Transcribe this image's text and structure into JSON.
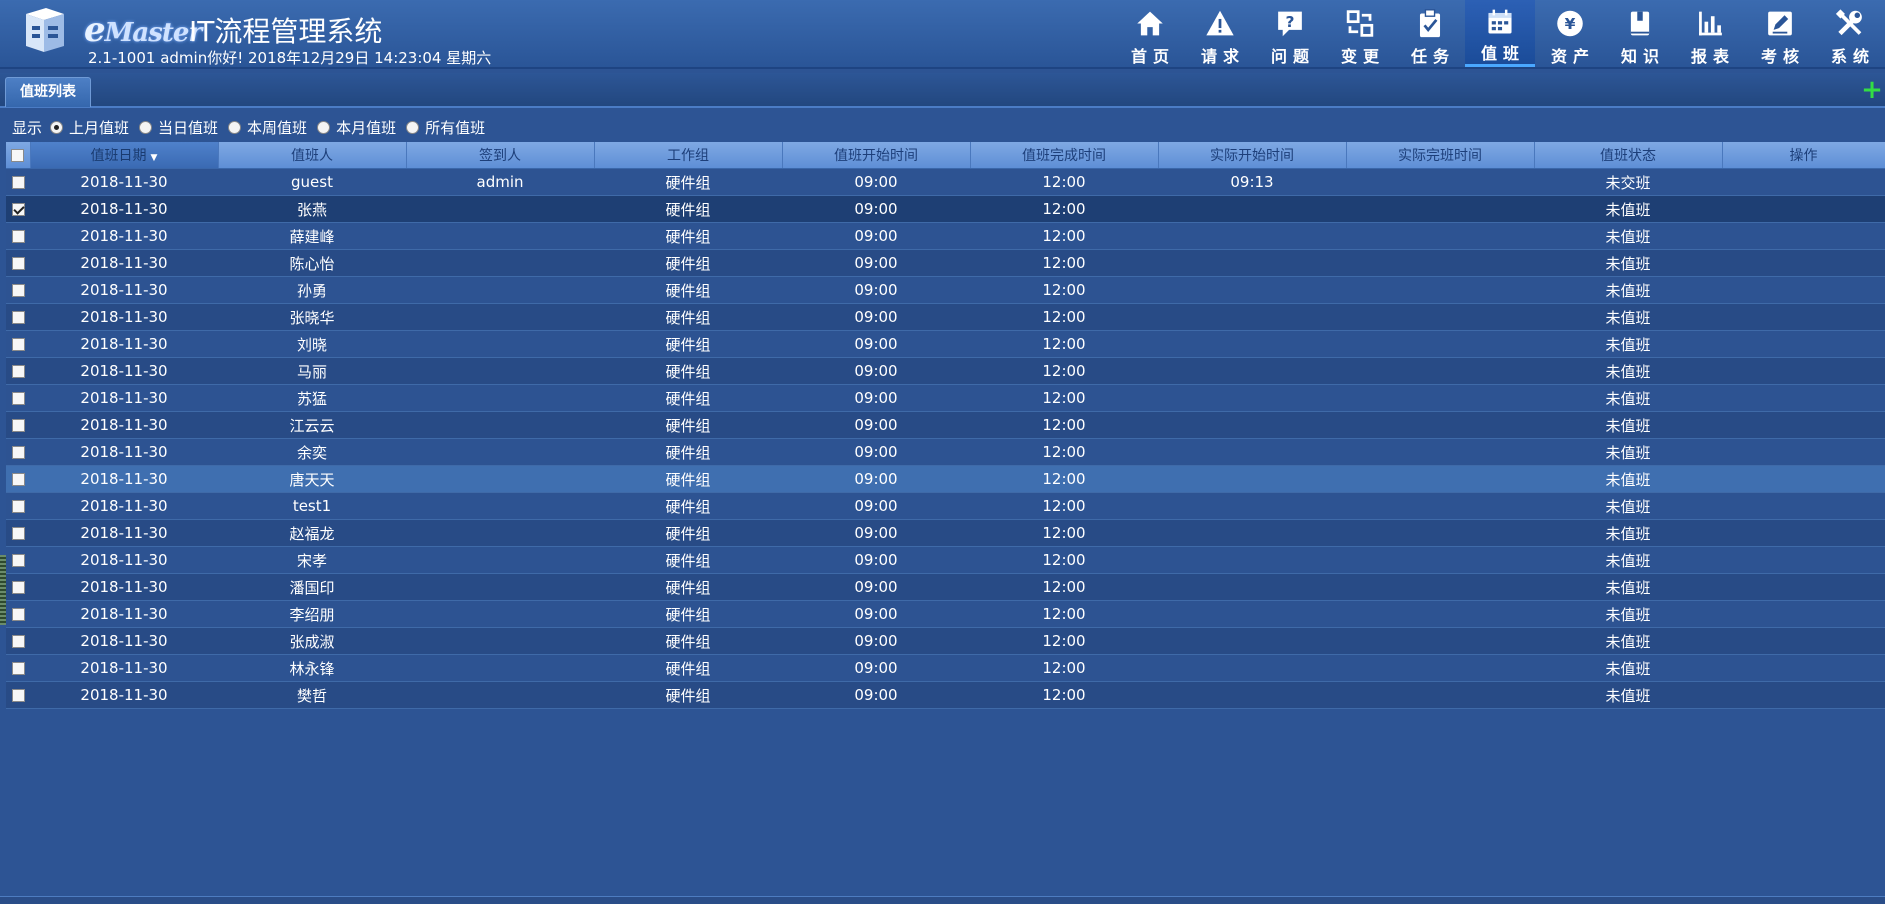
{
  "app": {
    "brand": "Master",
    "brand_initial": "e",
    "title": "IT流程管理系统",
    "user_line": "2.1-1001 admin你好!  2018年12月29日 14:23:04 星期六"
  },
  "nav": [
    {
      "label": "首页",
      "icon": "home-icon"
    },
    {
      "label": "请求",
      "icon": "warning-icon"
    },
    {
      "label": "问题",
      "icon": "question-icon"
    },
    {
      "label": "变更",
      "icon": "swap-icon"
    },
    {
      "label": "任务",
      "icon": "task-clipboard-icon"
    },
    {
      "label": "值班",
      "icon": "calendar-icon",
      "active": true
    },
    {
      "label": "资产",
      "icon": "yen-icon"
    },
    {
      "label": "知识",
      "icon": "book-icon"
    },
    {
      "label": "报表",
      "icon": "bar-chart-icon"
    },
    {
      "label": "考核",
      "icon": "edit-icon"
    },
    {
      "label": "系统",
      "icon": "tools-icon"
    }
  ],
  "tab": {
    "label": "值班列表"
  },
  "add_button": {
    "label": "+"
  },
  "filter": {
    "label": "显示",
    "options": [
      "上月值班",
      "当日值班",
      "本周值班",
      "本月值班",
      "所有值班"
    ],
    "selected": 0
  },
  "columns": [
    "值班日期",
    "值班人",
    "签到人",
    "工作组",
    "值班开始时间",
    "值班完成时间",
    "实际开始时间",
    "实际完班时间",
    "值班状态",
    "操作"
  ],
  "rows": [
    {
      "date": "2018-11-30",
      "person": "guest",
      "signer": "admin",
      "group": "硬件组",
      "start": "09:00",
      "end": "12:00",
      "actual_start": "09:13",
      "actual_end": "",
      "status": "未交班",
      "checked": false
    },
    {
      "date": "2018-11-30",
      "person": "张燕",
      "signer": "",
      "group": "硬件组",
      "start": "09:00",
      "end": "12:00",
      "actual_start": "",
      "actual_end": "",
      "status": "未值班",
      "checked": true
    },
    {
      "date": "2018-11-30",
      "person": "薛建峰",
      "signer": "",
      "group": "硬件组",
      "start": "09:00",
      "end": "12:00",
      "actual_start": "",
      "actual_end": "",
      "status": "未值班",
      "checked": false
    },
    {
      "date": "2018-11-30",
      "person": "陈心怡",
      "signer": "",
      "group": "硬件组",
      "start": "09:00",
      "end": "12:00",
      "actual_start": "",
      "actual_end": "",
      "status": "未值班",
      "checked": false
    },
    {
      "date": "2018-11-30",
      "person": "孙勇",
      "signer": "",
      "group": "硬件组",
      "start": "09:00",
      "end": "12:00",
      "actual_start": "",
      "actual_end": "",
      "status": "未值班",
      "checked": false
    },
    {
      "date": "2018-11-30",
      "person": "张晓华",
      "signer": "",
      "group": "硬件组",
      "start": "09:00",
      "end": "12:00",
      "actual_start": "",
      "actual_end": "",
      "status": "未值班",
      "checked": false
    },
    {
      "date": "2018-11-30",
      "person": "刘晓",
      "signer": "",
      "group": "硬件组",
      "start": "09:00",
      "end": "12:00",
      "actual_start": "",
      "actual_end": "",
      "status": "未值班",
      "checked": false
    },
    {
      "date": "2018-11-30",
      "person": "马丽",
      "signer": "",
      "group": "硬件组",
      "start": "09:00",
      "end": "12:00",
      "actual_start": "",
      "actual_end": "",
      "status": "未值班",
      "checked": false
    },
    {
      "date": "2018-11-30",
      "person": "苏猛",
      "signer": "",
      "group": "硬件组",
      "start": "09:00",
      "end": "12:00",
      "actual_start": "",
      "actual_end": "",
      "status": "未值班",
      "checked": false
    },
    {
      "date": "2018-11-30",
      "person": "江云云",
      "signer": "",
      "group": "硬件组",
      "start": "09:00",
      "end": "12:00",
      "actual_start": "",
      "actual_end": "",
      "status": "未值班",
      "checked": false
    },
    {
      "date": "2018-11-30",
      "person": "余奕",
      "signer": "",
      "group": "硬件组",
      "start": "09:00",
      "end": "12:00",
      "actual_start": "",
      "actual_end": "",
      "status": "未值班",
      "checked": false
    },
    {
      "date": "2018-11-30",
      "person": "唐天天",
      "signer": "",
      "group": "硬件组",
      "start": "09:00",
      "end": "12:00",
      "actual_start": "",
      "actual_end": "",
      "status": "未值班",
      "checked": false
    },
    {
      "date": "2018-11-30",
      "person": "test1",
      "signer": "",
      "group": "硬件组",
      "start": "09:00",
      "end": "12:00",
      "actual_start": "",
      "actual_end": "",
      "status": "未值班",
      "checked": false
    },
    {
      "date": "2018-11-30",
      "person": "赵福龙",
      "signer": "",
      "group": "硬件组",
      "start": "09:00",
      "end": "12:00",
      "actual_start": "",
      "actual_end": "",
      "status": "未值班",
      "checked": false
    },
    {
      "date": "2018-11-30",
      "person": "宋孝",
      "signer": "",
      "group": "硬件组",
      "start": "09:00",
      "end": "12:00",
      "actual_start": "",
      "actual_end": "",
      "status": "未值班",
      "checked": false
    },
    {
      "date": "2018-11-30",
      "person": "潘国印",
      "signer": "",
      "group": "硬件组",
      "start": "09:00",
      "end": "12:00",
      "actual_start": "",
      "actual_end": "",
      "status": "未值班",
      "checked": false
    },
    {
      "date": "2018-11-30",
      "person": "李绍朋",
      "signer": "",
      "group": "硬件组",
      "start": "09:00",
      "end": "12:00",
      "actual_start": "",
      "actual_end": "",
      "status": "未值班",
      "checked": false
    },
    {
      "date": "2018-11-30",
      "person": "张成淑",
      "signer": "",
      "group": "硬件组",
      "start": "09:00",
      "end": "12:00",
      "actual_start": "",
      "actual_end": "",
      "status": "未值班",
      "checked": false
    },
    {
      "date": "2018-11-30",
      "person": "林永锋",
      "signer": "",
      "group": "硬件组",
      "start": "09:00",
      "end": "12:00",
      "actual_start": "",
      "actual_end": "",
      "status": "未值班",
      "checked": false
    },
    {
      "date": "2018-11-30",
      "person": "樊哲",
      "signer": "",
      "group": "硬件组",
      "start": "09:00",
      "end": "12:00",
      "actual_start": "",
      "actual_end": "",
      "status": "未值班",
      "checked": false
    }
  ],
  "colors": {
    "header_bg": "#2a5597",
    "link": "#5ec2ff",
    "late_time": "#ff2a2a",
    "add_green": "#33dd44"
  }
}
